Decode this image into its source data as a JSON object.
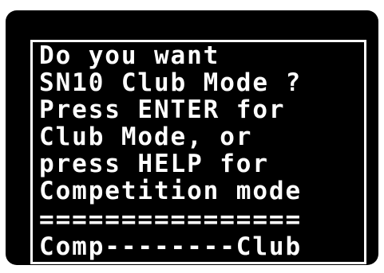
{
  "display": {
    "lines": [
      "Do you want",
      "SN10 Club Mode ?",
      "Press ENTER for",
      "Club Mode, or",
      "press HELP for",
      "Competition mode",
      "================",
      "Comp--------Club"
    ]
  },
  "colors": {
    "background": "#000000",
    "text": "#ffffff",
    "border": "#ffffff"
  }
}
